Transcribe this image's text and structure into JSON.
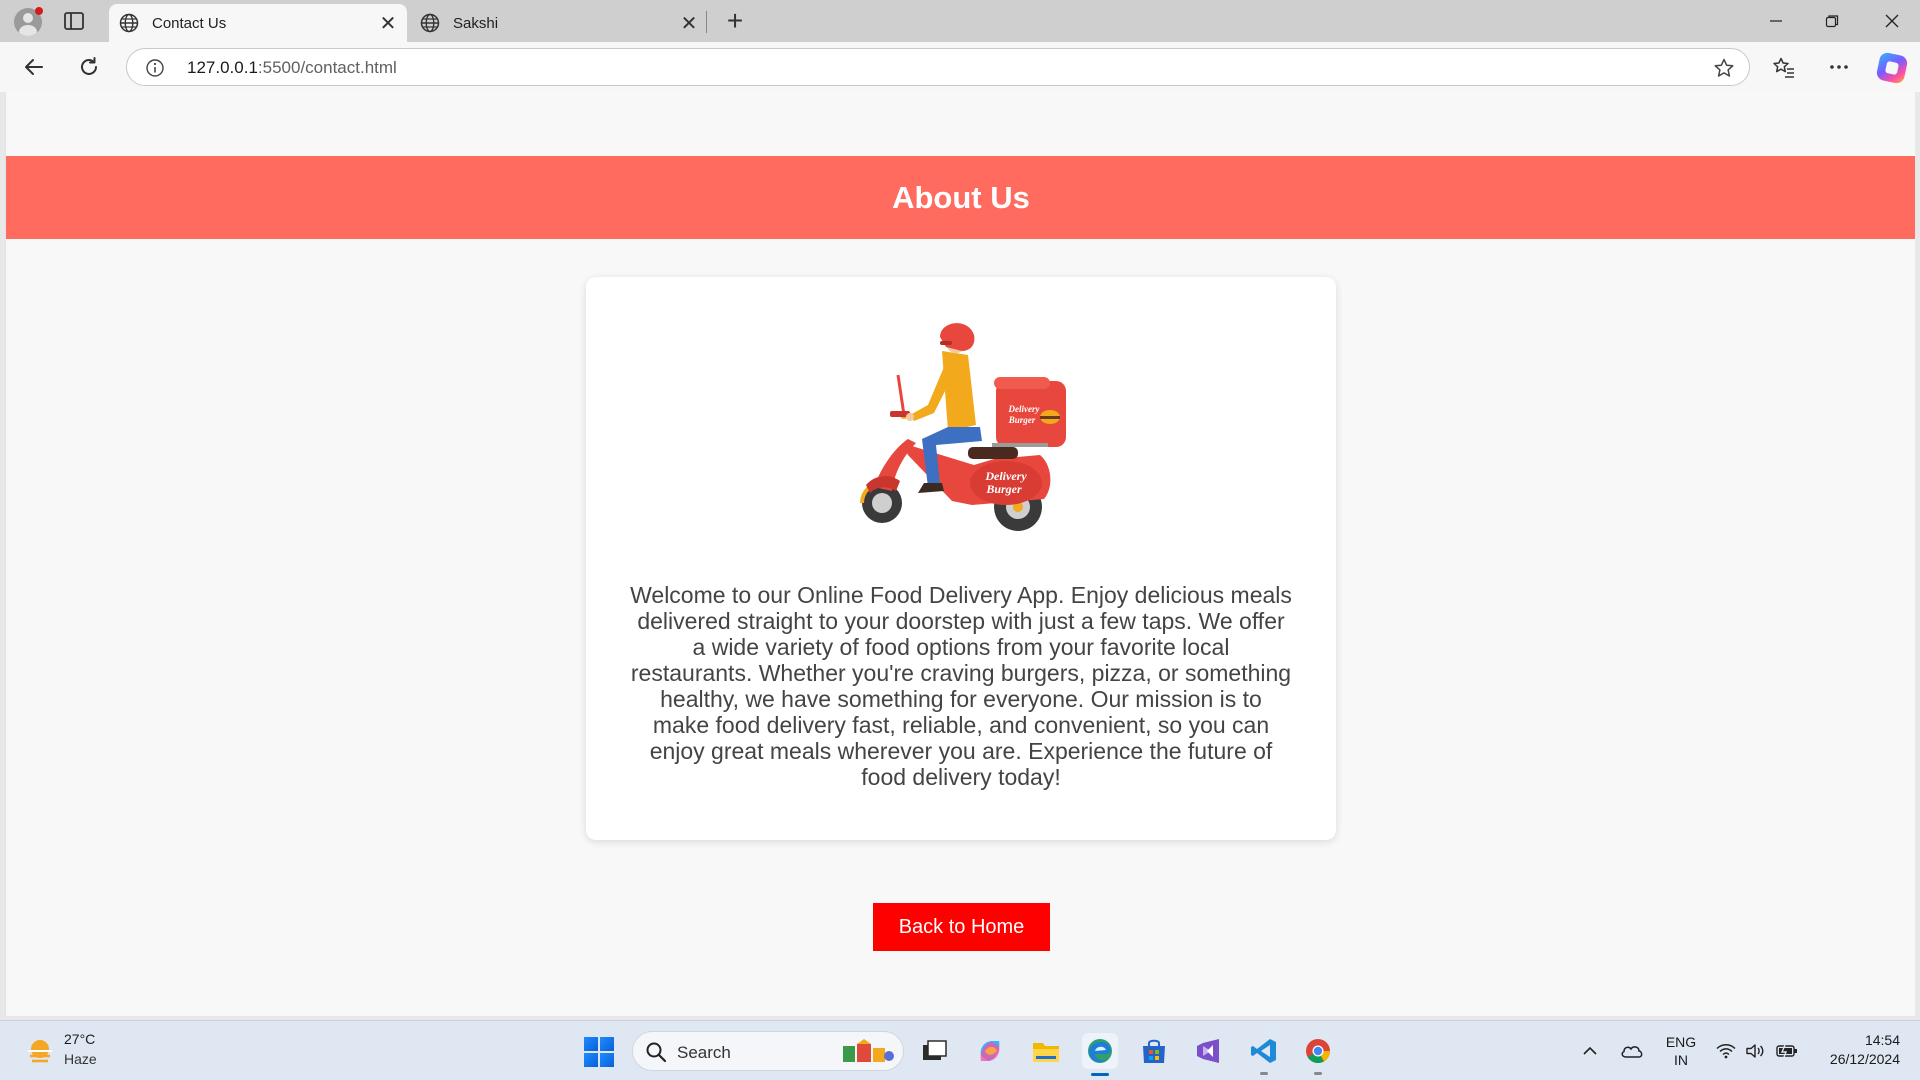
{
  "browser": {
    "tabs": [
      {
        "title": "Contact Us",
        "active": true
      },
      {
        "title": "Sakshi",
        "active": false
      }
    ],
    "address": {
      "host": "127.0.0.1",
      "rest": ":5500/contact.html"
    }
  },
  "page": {
    "header_title": "About Us",
    "illustration": {
      "box_label_1": "Delivery",
      "box_label_2": "Burger"
    },
    "about_text": "Welcome to our Online Food Delivery App. Enjoy delicious meals delivered straight to your doorstep with just a few taps. We offer a wide variety of food options from your favorite local restaurants. Whether you're craving burgers, pizza, or something healthy, we have something for everyone. Our mission is to make food delivery fast, reliable, and convenient, so you can enjoy great meals wherever you are. Experience the future of food delivery today!",
    "home_button": "Back to Home",
    "colors": {
      "header": "#ff6b5e",
      "button": "#ff0000"
    }
  },
  "taskbar": {
    "weather": {
      "temp": "27°C",
      "desc": "Haze"
    },
    "search_label": "Search",
    "lang": {
      "line1": "ENG",
      "line2": "IN"
    },
    "clock": {
      "time": "14:54",
      "date": "26/12/2024"
    }
  }
}
